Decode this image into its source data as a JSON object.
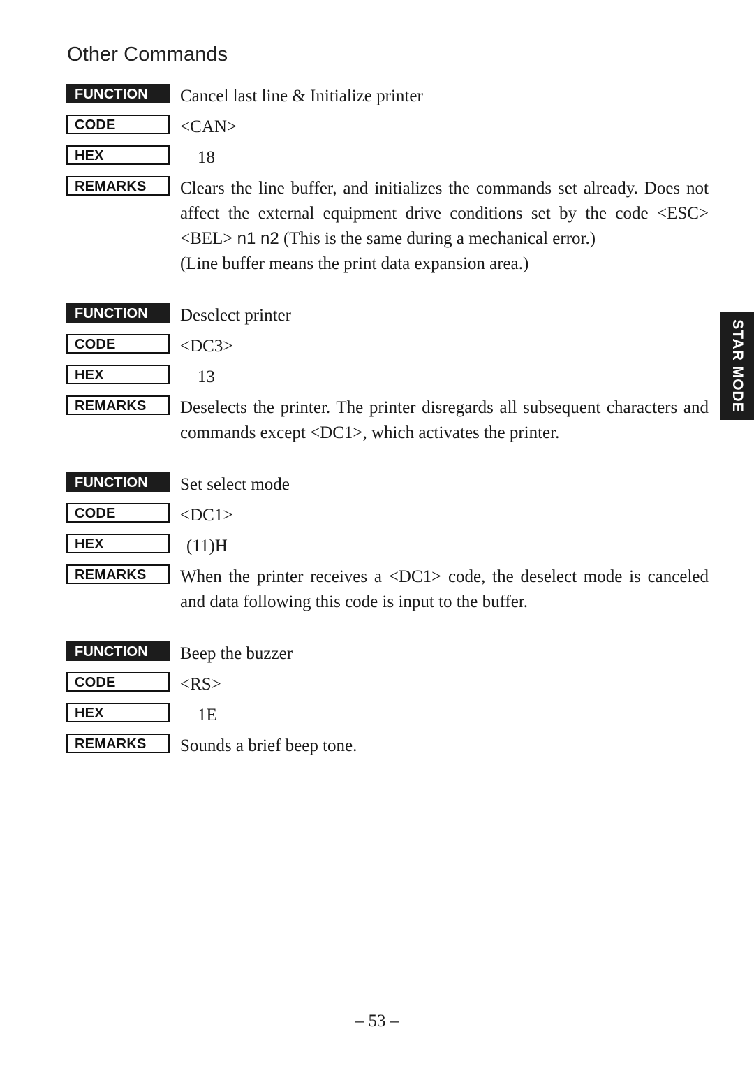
{
  "page": {
    "heading": "Other Commands",
    "page_number": "– 53 –",
    "side_tab_label": "STAR MODE"
  },
  "labels": {
    "function": "FUNCTION",
    "code": "CODE",
    "hex": "HEX",
    "remarks": "REMARKS"
  },
  "commands": [
    {
      "function": "Cancel last line & Initialize printer",
      "code": "<CAN>",
      "hex": "18",
      "remarks_lines": [
        "Clears the line buffer, and initializes the commands set already.",
        "Does not affect the external equipment drive conditions set by the",
        "code <ESC> <BEL> ",
        "n1 n2",
        " (This is the same during a mechanical error.)",
        "(Line buffer means the print data expansion area.)"
      ],
      "remarks_para_1_a": "Clears the line buffer, and initializes the commands set already. Does not affect the external equipment drive conditions set by the code <ESC> <BEL> ",
      "remarks_para_1_sans": "n1 n2",
      "remarks_para_1_b": " (This is the same during a mechanical error.)",
      "remarks_para_2": "(Line buffer means the print data expansion area.)"
    },
    {
      "function": "Deselect printer",
      "code": "<DC3>",
      "hex": "13",
      "remarks_para_1": "Deselects the printer. The printer disregards all subsequent characters and commands except <DC1>, which activates the printer."
    },
    {
      "function": "Set select mode",
      "code": "<DC1>",
      "hex": "(11)H",
      "remarks_para_1": "When the printer receives a <DC1> code, the deselect mode is canceled and data following this code is input to the buffer."
    },
    {
      "function": "Beep the buzzer",
      "code": "<RS>",
      "hex": "1E",
      "remarks_para_1": "Sounds a brief beep tone."
    }
  ]
}
